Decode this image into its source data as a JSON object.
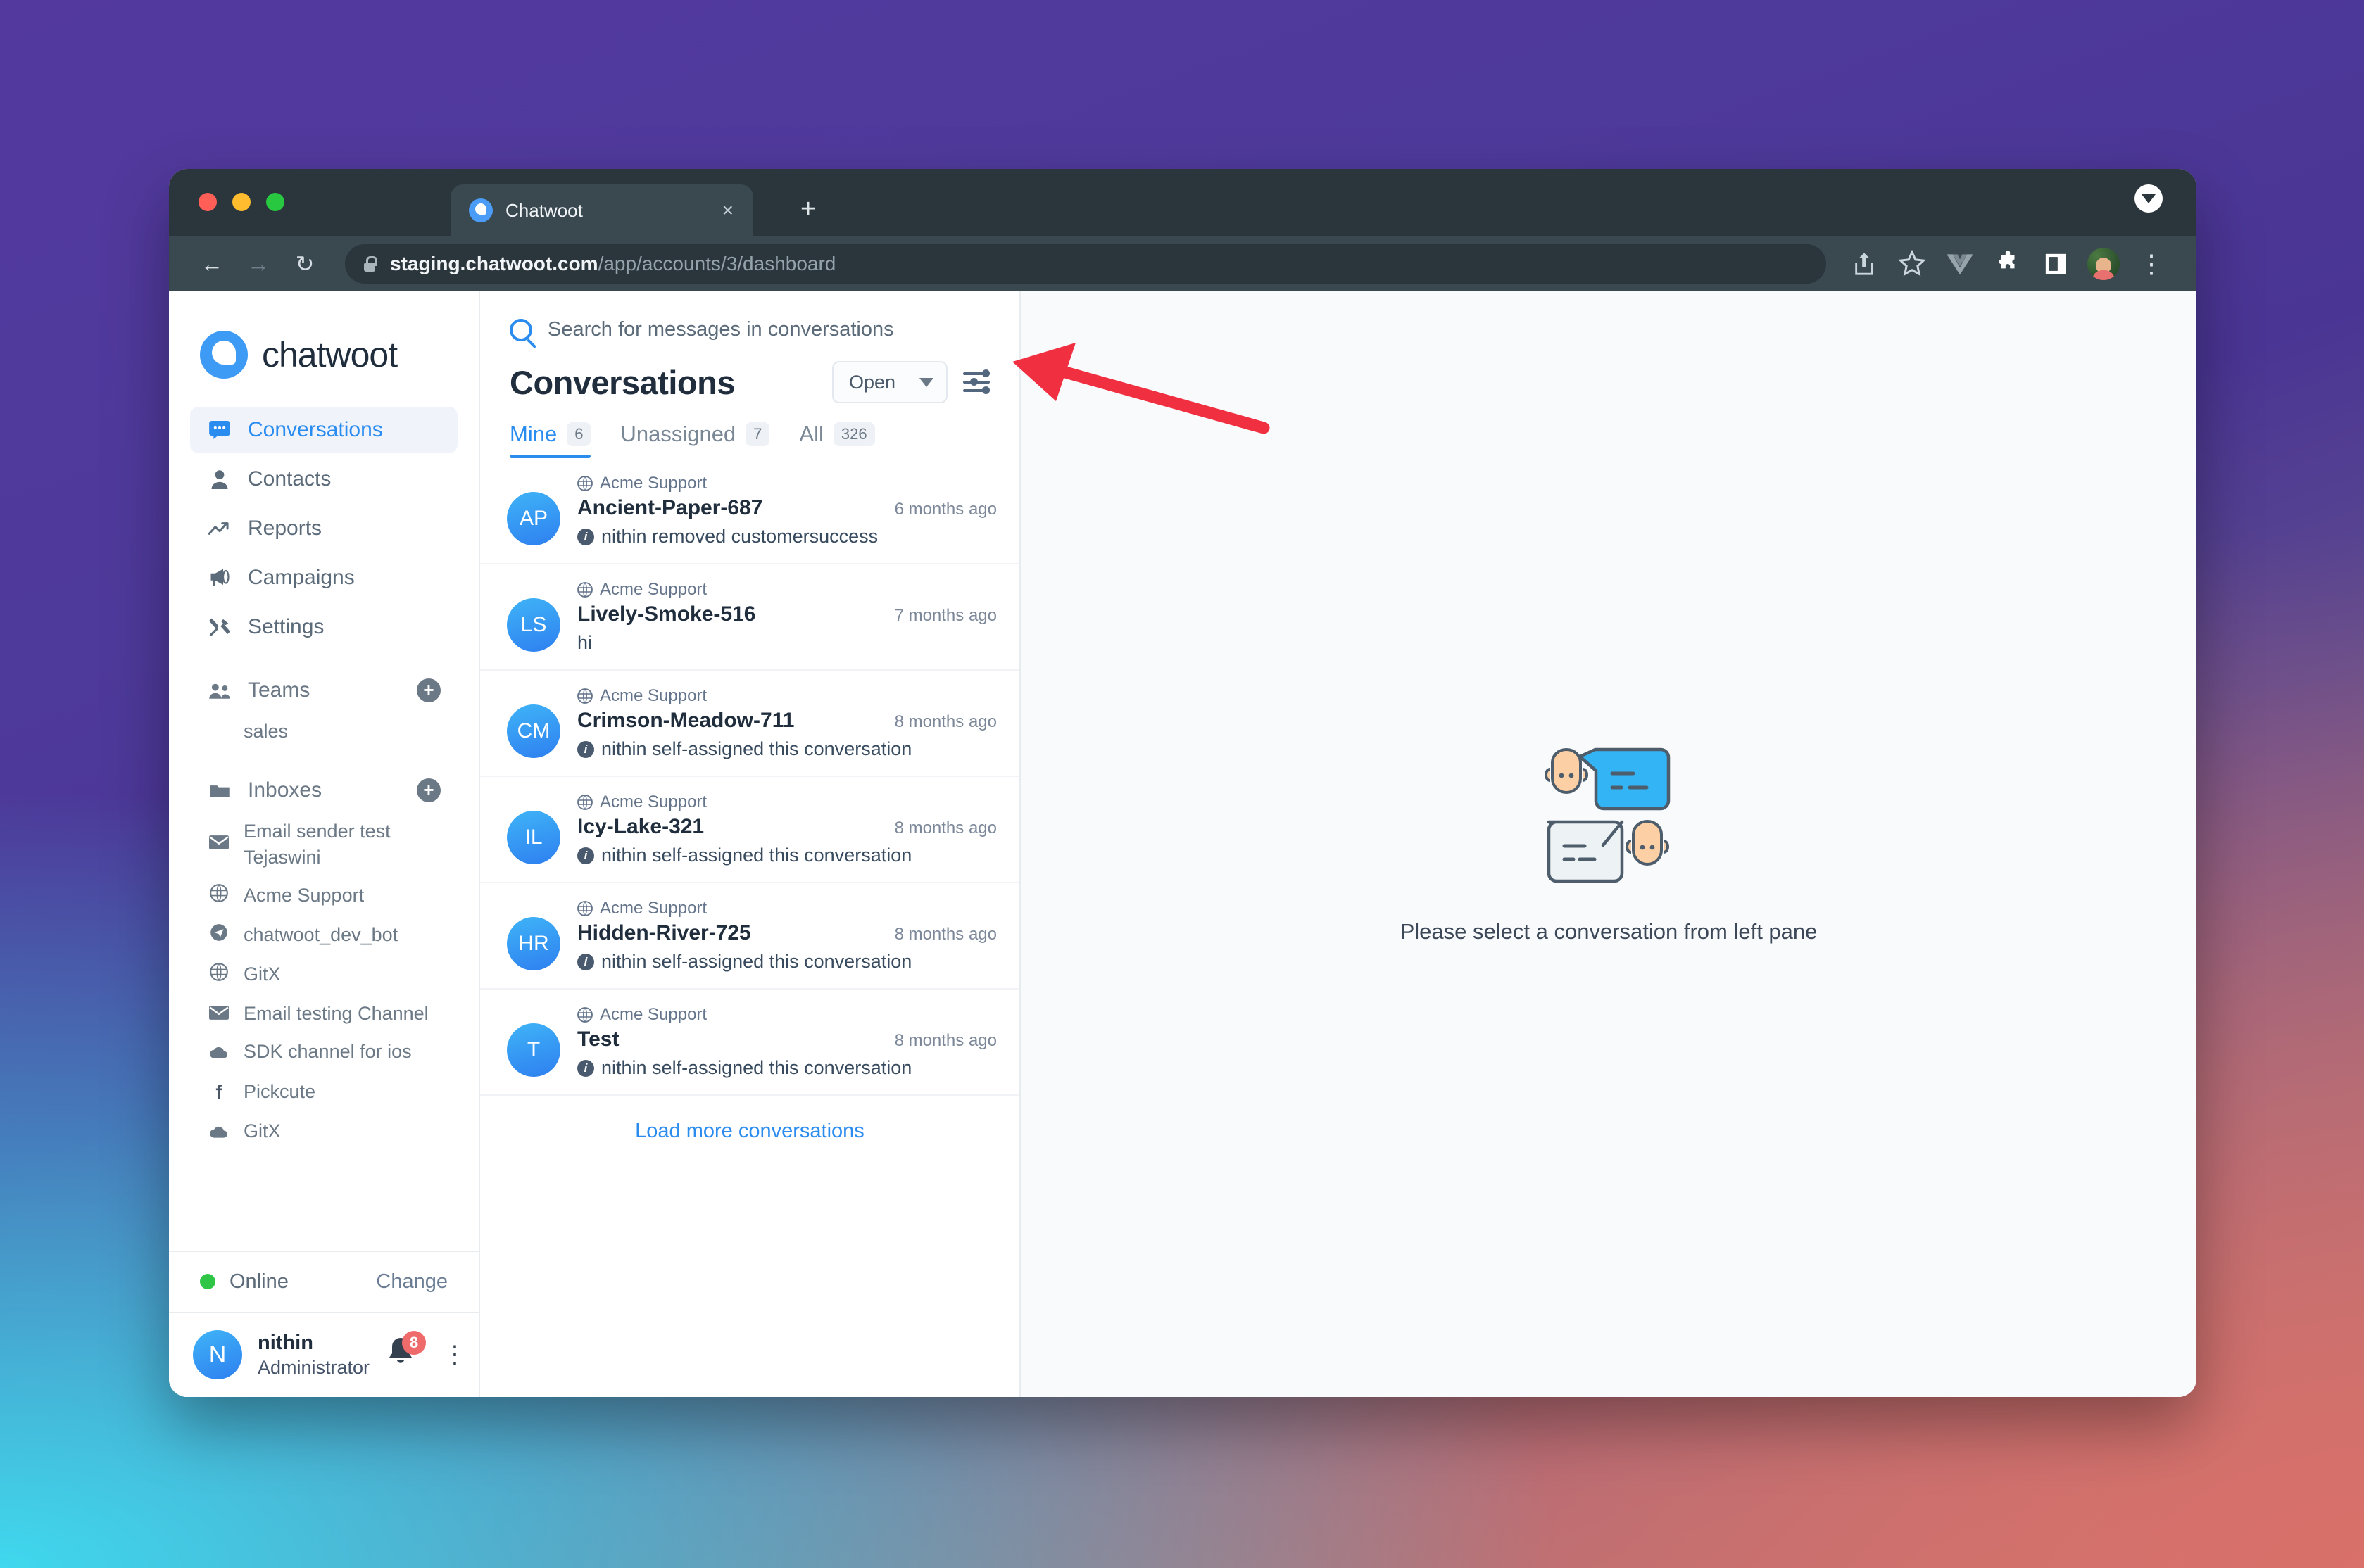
{
  "browser": {
    "tab_title": "Chatwoot",
    "tab_close_glyph": "×",
    "new_tab_glyph": "+",
    "back_glyph": "←",
    "forward_glyph": "→",
    "reload_glyph": "↻",
    "url_host": "staging.chatwoot.com",
    "url_path": "/app/accounts/3/dashboard",
    "share_glyph": "↑",
    "bookmark_glyph": "☆",
    "vue_glyph": "V",
    "extensions_glyph": "✦",
    "sidepanel_glyph": "▣",
    "menu_glyph": "⋮"
  },
  "sidebar": {
    "logo_text": "chatwoot",
    "nav": [
      {
        "label": "Conversations",
        "icon": "chat-icon",
        "glyph": "■",
        "active": true
      },
      {
        "label": "Contacts",
        "icon": "person-icon",
        "glyph": "👤",
        "active": false
      },
      {
        "label": "Reports",
        "icon": "trend-up-icon",
        "glyph": "↗",
        "active": false
      },
      {
        "label": "Campaigns",
        "icon": "megaphone-icon",
        "glyph": "📢",
        "active": false
      },
      {
        "label": "Settings",
        "icon": "tools-icon",
        "glyph": "⚒",
        "active": false
      }
    ],
    "teams": {
      "label": "Teams",
      "icon": "people-icon",
      "glyph": "👥",
      "add_glyph": "+",
      "items": [
        {
          "label": "sales"
        }
      ]
    },
    "inboxes": {
      "label": "Inboxes",
      "icon": "folder-icon",
      "glyph": "🗀",
      "add_glyph": "+",
      "items": [
        {
          "label": "Email sender test Tejaswini",
          "icon": "email-icon",
          "glyph": "✉"
        },
        {
          "label": "Acme Support",
          "icon": "globe-icon",
          "glyph": "🌐"
        },
        {
          "label": "chatwoot_dev_bot",
          "icon": "telegram-icon",
          "glyph": "➤"
        },
        {
          "label": "GitX",
          "icon": "globe-icon",
          "glyph": "🌐"
        },
        {
          "label": "Email testing Channel",
          "icon": "email-icon",
          "glyph": "✉"
        },
        {
          "label": "SDK channel for ios",
          "icon": "cloud-icon",
          "glyph": "☁"
        },
        {
          "label": "Pickcute",
          "icon": "facebook-icon",
          "glyph": "f"
        },
        {
          "label": "GitX",
          "icon": "cloud-icon",
          "glyph": "☁"
        }
      ]
    },
    "status": {
      "label": "Online",
      "change_label": "Change",
      "color": "#2fc648"
    },
    "profile": {
      "initial": "N",
      "name": "nithin",
      "role": "Administrator",
      "notification_count": "8",
      "bell_glyph": "🔔",
      "menu_glyph": "⋮"
    }
  },
  "conversations": {
    "search_placeholder": "Search for messages in conversations",
    "title": "Conversations",
    "status_filter": "Open",
    "tabs": [
      {
        "label": "Mine",
        "count": "6",
        "selected": true
      },
      {
        "label": "Unassigned",
        "count": "7",
        "selected": false
      },
      {
        "label": "All",
        "count": "326",
        "selected": false
      }
    ],
    "items": [
      {
        "initials": "AP",
        "inbox": "Acme Support",
        "name": "Ancient-Paper-687",
        "time": "6 months ago",
        "message": "nithin removed customersuccess",
        "has_info": true
      },
      {
        "initials": "LS",
        "inbox": "Acme Support",
        "name": "Lively-Smoke-516",
        "time": "7 months ago",
        "message": "hi",
        "has_info": false
      },
      {
        "initials": "CM",
        "inbox": "Acme Support",
        "name": "Crimson-Meadow-711",
        "time": "8 months ago",
        "message": "nithin self-assigned this conversation",
        "has_info": true
      },
      {
        "initials": "IL",
        "inbox": "Acme Support",
        "name": "Icy-Lake-321",
        "time": "8 months ago",
        "message": "nithin self-assigned this conversation",
        "has_info": true
      },
      {
        "initials": "HR",
        "inbox": "Acme Support",
        "name": "Hidden-River-725",
        "time": "8 months ago",
        "message": "nithin self-assigned this conversation",
        "has_info": true
      },
      {
        "initials": "T",
        "inbox": "Acme Support",
        "name": "Test",
        "time": "8 months ago",
        "message": "nithin self-assigned this conversation",
        "has_info": true
      }
    ],
    "load_more": "Load more conversations"
  },
  "empty_state": {
    "message": "Please select a conversation from left pane"
  },
  "annotation": {
    "color": "#f03040",
    "points_to": "filter-conversations-icon"
  },
  "colors": {
    "accent": "#2b8cf0",
    "avatar_from": "#3fb4f7",
    "avatar_to": "#2e7ff0",
    "badge": "#ef6a6a",
    "online": "#2fc648"
  }
}
